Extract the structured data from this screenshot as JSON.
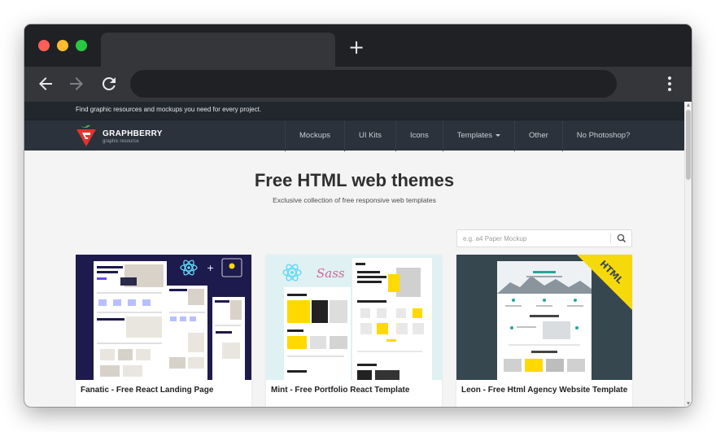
{
  "browser": {
    "new_tab_symbol": "+",
    "icons": [
      "back-arrow-icon",
      "forward-arrow-icon",
      "reload-icon",
      "kebab-menu-icon",
      "new-tab-icon"
    ]
  },
  "site": {
    "topbar_text": "Find graphic resources and mockups you need for every project.",
    "logo": {
      "name": "GRAPHBERRY",
      "tagline": "graphic resource"
    },
    "nav": [
      "Mockups",
      "UI Kits",
      "Icons",
      "Templates",
      "Other",
      "No Photoshop?"
    ]
  },
  "hero": {
    "title": "Free HTML web themes",
    "subtitle": "Exclusive collection of free responsive web templates"
  },
  "search": {
    "placeholder": "e.g. a4 Paper Mockup",
    "icon": "search-icon"
  },
  "cards": [
    {
      "title": "Fanatic - Free React Landing Page"
    },
    {
      "title": "Mint - Free Portfolio React Template",
      "badge_text": "Sass"
    },
    {
      "title": "Leon - Free Html Agency Website Template",
      "ribbon": "HTML"
    }
  ],
  "colors": {
    "brand_red": "#e5322d",
    "navbar": "#2b323b",
    "topbar": "#22272e",
    "card1_bg": "#1d1a4d",
    "card2_bg": "#dff1f3",
    "card3_bg": "#37474f",
    "ribbon_yellow": "#f5d90a"
  }
}
